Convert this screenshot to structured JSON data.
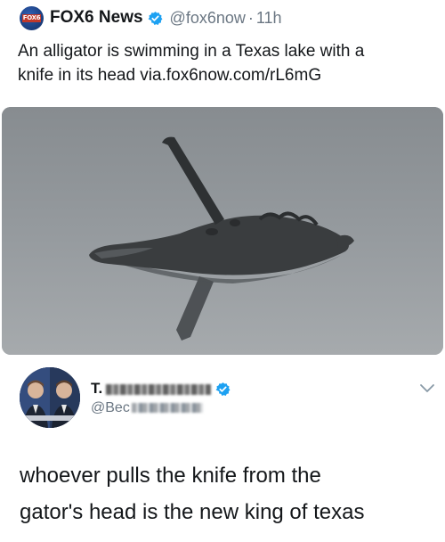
{
  "quoted_tweet": {
    "account_name": "FOX6 News",
    "handle": "@fox6now",
    "separator": "·",
    "time": "11h",
    "avatar_label": "FOX6",
    "text_line1": "An alligator is swimming in a Texas lake with a",
    "text_line2": "knife in its head via.fox6now.com/rL6mG",
    "verified": true,
    "media": {
      "subject": "alligator-with-knife-photo"
    }
  },
  "reply_tweet": {
    "name_visible": "T.",
    "name_obscured": "Becket Adams",
    "handle_visible": "@Bec",
    "handle_obscured": "ketAdams",
    "verified": true,
    "text_line1": "whoever pulls the knife from the",
    "text_line2": "gator's head is the new king of texas"
  },
  "colors": {
    "verified_blue": "#1da1f2",
    "text": "#14171a",
    "muted": "#6b7783",
    "water": "#969b9f"
  }
}
